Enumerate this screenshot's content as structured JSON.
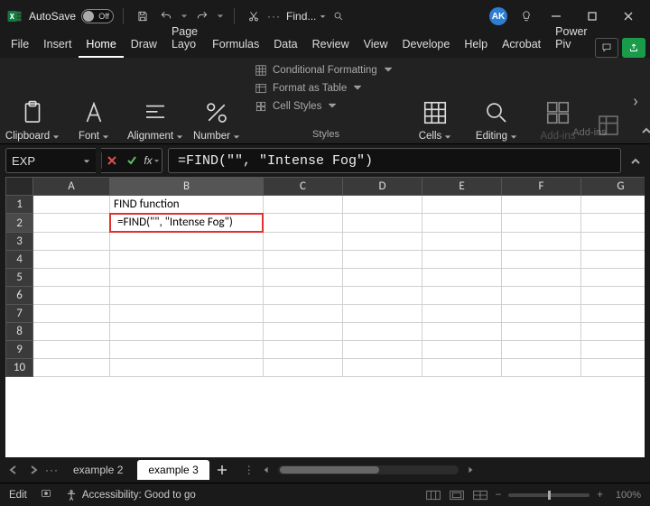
{
  "titlebar": {
    "autosave_label": "AutoSave",
    "autosave_state": "Off",
    "search_label": "Find...",
    "avatar_initials": "AK"
  },
  "menu": {
    "items": [
      "File",
      "Insert",
      "Home",
      "Draw",
      "Page Layo",
      "Formulas",
      "Data",
      "Review",
      "View",
      "Develope",
      "Help",
      "Acrobat",
      "Power Piv"
    ],
    "active_index": 2
  },
  "ribbon": {
    "clipboard": "Clipboard",
    "font": "Font",
    "alignment": "Alignment",
    "number": "Number",
    "styles_header": "Styles",
    "cond_format": "Conditional Formatting",
    "format_table": "Format as Table",
    "cell_styles": "Cell Styles",
    "cells": "Cells",
    "editing": "Editing",
    "addins": "Add-ins",
    "addins_footer": "Add-ins"
  },
  "formula_bar": {
    "name_box": "EXP",
    "formula": "=FIND(\"\", \"Intense Fog\")"
  },
  "grid": {
    "columns": [
      "A",
      "B",
      "C",
      "D",
      "E",
      "F",
      "G"
    ],
    "rows": [
      "1",
      "2",
      "3",
      "4",
      "5",
      "6",
      "7",
      "8",
      "9",
      "10"
    ],
    "b1": "FIND function",
    "b2": "=FIND(\"\", \"Intense Fog\")"
  },
  "sheets": {
    "tabs": [
      "example 2",
      "example 3"
    ],
    "active_index": 1
  },
  "status": {
    "mode": "Edit",
    "a11y": "Accessibility: Good to go",
    "zoom": "100%"
  }
}
